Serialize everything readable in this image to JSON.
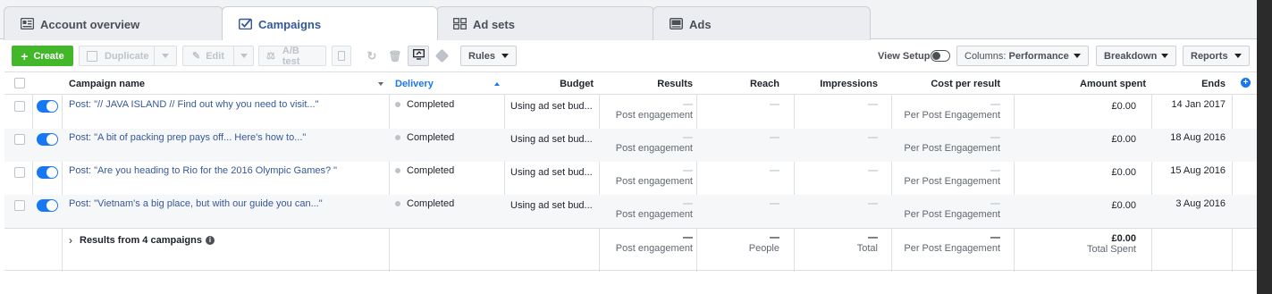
{
  "tabs": [
    {
      "label": "Account overview",
      "icon": "account-overview-icon"
    },
    {
      "label": "Campaigns",
      "icon": "campaigns-checkbox-icon"
    },
    {
      "label": "Ad sets",
      "icon": "ad-sets-grid-icon"
    },
    {
      "label": "Ads",
      "icon": "ads-icon"
    }
  ],
  "toolbar": {
    "create_label": "Create",
    "duplicate_label": "Duplicate",
    "edit_label": "Edit",
    "ab_test_label": "A/B test",
    "rules_label": "Rules",
    "view_setup_label": "View Setup",
    "columns_prefix": "Columns:",
    "columns_value": "Performance",
    "breakdown_label": "Breakdown",
    "reports_label": "Reports"
  },
  "table": {
    "headers": {
      "campaign_name": "Campaign name",
      "delivery": "Delivery",
      "budget": "Budget",
      "results": "Results",
      "reach": "Reach",
      "impressions": "Impressions",
      "cost_per_result": "Cost per result",
      "amount_spent": "Amount spent",
      "ends": "Ends"
    },
    "rows": [
      {
        "name": "Post: \"// JAVA ISLAND // Find out why you need to visit...\"",
        "delivery": "Completed",
        "budget": "Using ad set bud...",
        "results": "—",
        "results_sub": "Post engagement",
        "reach": "—",
        "impressions": "—",
        "cost": "—",
        "cost_sub": "Per Post Engagement",
        "amount": "£0.00",
        "ends": "14 Jan 2017"
      },
      {
        "name": "Post: \"A bit of packing prep pays off... Here's how to...\"",
        "delivery": "Completed",
        "budget": "Using ad set bud...",
        "results": "—",
        "results_sub": "Post engagement",
        "reach": "—",
        "impressions": "—",
        "cost": "—",
        "cost_sub": "Per Post Engagement",
        "amount": "£0.00",
        "ends": "18 Aug 2016"
      },
      {
        "name": "Post: \"Are you heading to Rio for the 2016 Olympic Games? \"",
        "delivery": "Completed",
        "budget": "Using ad set bud...",
        "results": "—",
        "results_sub": "Post engagement",
        "reach": "—",
        "impressions": "—",
        "cost": "—",
        "cost_sub": "Per Post Engagement",
        "amount": "£0.00",
        "ends": "15 Aug 2016"
      },
      {
        "name": "Post: \"Vietnam's a big place, but with our guide you can...\"",
        "delivery": "Completed",
        "budget": "Using ad set bud...",
        "results": "—",
        "results_sub": "Post engagement",
        "reach": "—",
        "impressions": "—",
        "cost": "—",
        "cost_sub": "Per Post Engagement",
        "amount": "£0.00",
        "ends": "3 Aug 2016"
      }
    ],
    "summary": {
      "label": "Results from 4 campaigns",
      "results": "—",
      "results_sub": "Post engagement",
      "reach": "—",
      "reach_sub": "People",
      "impressions": "—",
      "impressions_sub": "Total",
      "cost": "—",
      "cost_sub": "Per Post Engagement",
      "amount": "£0.00",
      "amount_sub": "Total Spent"
    }
  },
  "colors": {
    "create_green": "#42b72a",
    "link_blue": "#365899",
    "toggle_blue": "#1877f2",
    "delivery_header": "#1877f2"
  }
}
